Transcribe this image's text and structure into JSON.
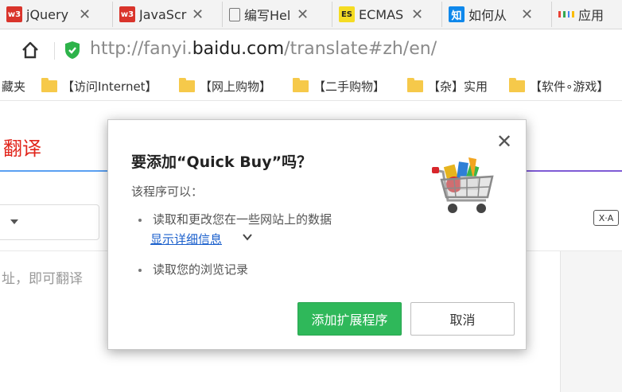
{
  "tabs": [
    {
      "title": "jQuery",
      "icon": "w3schools-icon",
      "icon_text": "w3"
    },
    {
      "title": "JavaScr",
      "icon": "w3schools-icon",
      "icon_text": "w3"
    },
    {
      "title": "编写Hel",
      "icon": "document-icon",
      "icon_text": ""
    },
    {
      "title": "ECMAS",
      "icon": "es-icon",
      "icon_text": "ES"
    },
    {
      "title": "如何从",
      "icon": "zhihu-icon",
      "icon_text": "知"
    },
    {
      "title": "应用",
      "icon": "apps-icon",
      "icon_text": ""
    }
  ],
  "tab_close_glyph": "✕",
  "address": {
    "prefix": "http://fanyi.",
    "domain": "baidu.com",
    "path": "/translate#zh/en/"
  },
  "bookmarks": {
    "partial_first": "藏夹",
    "items": [
      "【访问Internet】",
      "【网上购物】",
      "【二手购物】",
      "【杂】实用",
      "【软件∘游戏】"
    ]
  },
  "page": {
    "logo_fragment": "翻译",
    "input_placeholder": "址，即可翻译",
    "xa_label": "X·A"
  },
  "dialog": {
    "title": "要添加“Quick Buy”吗？",
    "subtitle": "该程序可以：",
    "permissions": [
      "读取和更改您在一些网站上的数据",
      "读取您的浏览记录"
    ],
    "details_link": "显示详细信息",
    "add_button": "添加扩展程序",
    "cancel_button": "取消",
    "close_glyph": "✕"
  },
  "colors": {
    "add_button": "#2fb85a",
    "link": "#1a5fcc",
    "logo": "#e1251b",
    "accent_blue": "#5aa0f2",
    "accent_purple": "#7f5bd5"
  }
}
